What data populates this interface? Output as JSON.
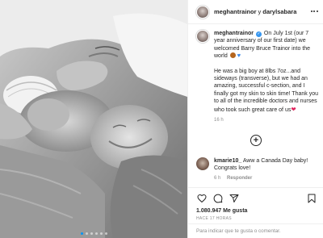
{
  "header": {
    "username": "meghantrainor",
    "separator": "y",
    "coauthor": "darylsabara",
    "more_icon": "more-horizontal-icon"
  },
  "caption": {
    "username": "meghantrainor",
    "text_1": "On July 1st (our 7 year anniversary of our first date) we welcomed Barry Bruce Trainor into the world",
    "text_2": "He was a big boy at 8lbs 7oz...and sideways (transverse), but we had an amazing, successful c-section, and I finally got my skin to skin time! Thank you to all of the incredible doctors and nurses who took such great care of us",
    "red_heart": "❤",
    "blue_heart": "♥",
    "timestamp": "16 h"
  },
  "load_more_icon": "plus-circle-icon",
  "comment": {
    "username": "kmarie10_",
    "text": "Aww a Canada Day baby! Congrats love!",
    "time": "6 h",
    "reply": "Responder"
  },
  "actions": {
    "like_icon": "heart-outline-icon",
    "comment_icon": "comment-bubble-icon",
    "share_icon": "paper-plane-icon",
    "save_icon": "bookmark-icon"
  },
  "likes": "1.080.947 Me gusta",
  "date": "HACE 17 HORAS",
  "add_comment_placeholder": "Para indicar que te gusta o comentar.",
  "carousel": {
    "count": 6,
    "active": 0
  },
  "colors": {
    "verified": "#3897f0",
    "link_blue": "#0095f6",
    "secondary_text": "#8e8e8e",
    "border": "#efefef"
  }
}
